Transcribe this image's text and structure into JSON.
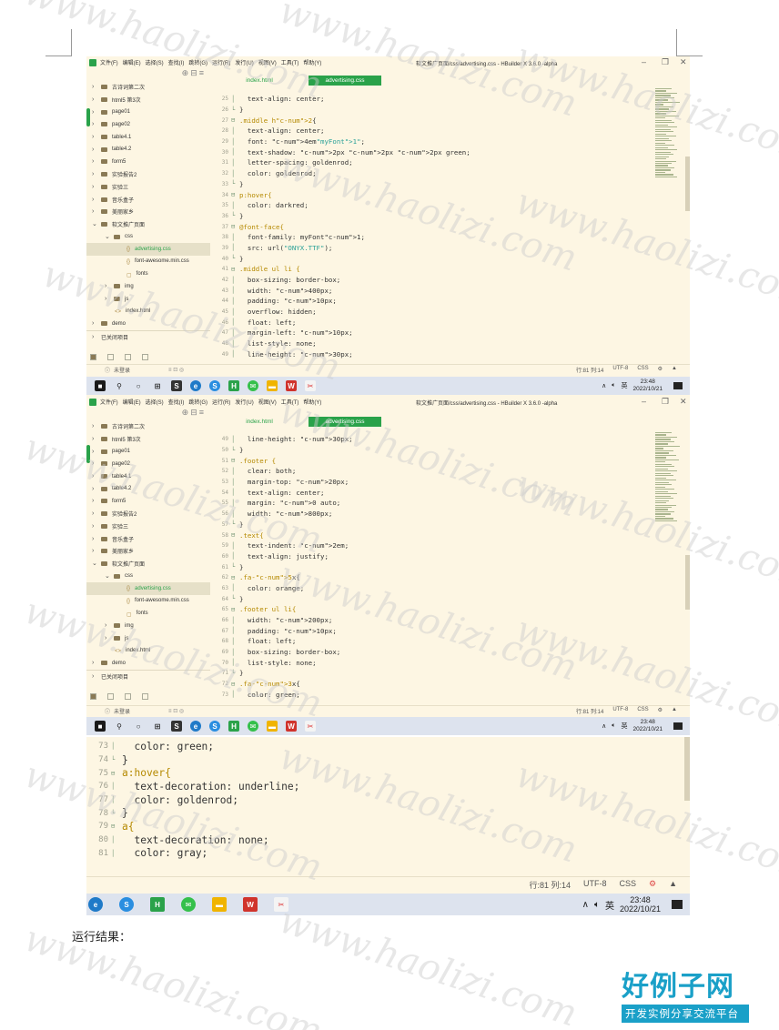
{
  "menu": {
    "items": [
      "文件(F)",
      "编辑(E)",
      "选择(S)",
      "查找(I)",
      "跳转(G)",
      "运行(R)",
      "发行(U)",
      "视图(V)",
      "工具(T)",
      "帮助(Y)"
    ],
    "window_title": "软文推广页面/css/advertising.css - HBuilder X 3.6.0 -alpha"
  },
  "tabs": [
    "index.html",
    "advertising.css"
  ],
  "sidebar": {
    "items": [
      "古诗词第二次",
      "html5 第3次",
      "page01",
      "page02",
      "table4.1",
      "table4.2",
      "form5",
      "实验报告2",
      "实验三",
      "音乐盒子",
      "美丽家乡",
      "软文推广页面",
      "css",
      "advertising.css",
      "font-awesome.min.css",
      "fonts",
      "img",
      "js",
      "index.html",
      "demo"
    ],
    "closed_label": "已关闭项目",
    "login": "未登录"
  },
  "status": {
    "pos1": "行:81  列:14",
    "encoding": "UTF-8",
    "lang": "CSS"
  },
  "tray": {
    "ime": "英",
    "time": "23:48",
    "date": "2022/10/21"
  },
  "code1": [
    {
      "n": "25",
      "t": "  text-align: center;"
    },
    {
      "n": "26",
      "t": "}"
    },
    {
      "n": "27",
      "t": ".middle h2{"
    },
    {
      "n": "28",
      "t": "  text-align: center;"
    },
    {
      "n": "29",
      "t": "  font: 4em\"myFont1\";"
    },
    {
      "n": "30",
      "t": "  text-shadow: 2px 2px 2px green;"
    },
    {
      "n": "31",
      "t": "  letter-spacing: goldenrod;"
    },
    {
      "n": "32",
      "t": "  color: goldenrod;"
    },
    {
      "n": "33",
      "t": "}"
    },
    {
      "n": "34",
      "t": "p:hover{"
    },
    {
      "n": "35",
      "t": "  color: darkred;"
    },
    {
      "n": "36",
      "t": "}"
    },
    {
      "n": "37",
      "t": "@font-face{"
    },
    {
      "n": "38",
      "t": "  font-family: myFont1;"
    },
    {
      "n": "39",
      "t": "  src: url(\"ONYX.TTF\");"
    },
    {
      "n": "40",
      "t": "}"
    },
    {
      "n": "41",
      "t": ".middle ul li {"
    },
    {
      "n": "42",
      "t": "  box-sizing: border-box;"
    },
    {
      "n": "43",
      "t": "  width: 400px;"
    },
    {
      "n": "44",
      "t": "  padding: 10px;"
    },
    {
      "n": "45",
      "t": "  overflow: hidden;"
    },
    {
      "n": "46",
      "t": "  float: left;"
    },
    {
      "n": "47",
      "t": "  margin-left: 10px;"
    },
    {
      "n": "48",
      "t": "  list-style: none;"
    },
    {
      "n": "49",
      "t": "  line-height: 30px;"
    }
  ],
  "code2": [
    {
      "n": "49",
      "t": "  line-height: 30px;"
    },
    {
      "n": "50",
      "t": "}"
    },
    {
      "n": "51",
      "t": ".footer {"
    },
    {
      "n": "52",
      "t": "  clear: both;"
    },
    {
      "n": "53",
      "t": "  margin-top: 20px;"
    },
    {
      "n": "54",
      "t": "  text-align: center;"
    },
    {
      "n": "55",
      "t": "  margin: 0 auto;"
    },
    {
      "n": "56",
      "t": "  width: 800px;"
    },
    {
      "n": "57",
      "t": "}"
    },
    {
      "n": "58",
      "t": ".text{"
    },
    {
      "n": "59",
      "t": "  text-indent: 2em;"
    },
    {
      "n": "60",
      "t": "  text-align: justify;"
    },
    {
      "n": "61",
      "t": "}"
    },
    {
      "n": "62",
      "t": ".fa-5x{"
    },
    {
      "n": "63",
      "t": "  color: orange;"
    },
    {
      "n": "64",
      "t": "}"
    },
    {
      "n": "65",
      "t": ".footer ul li{"
    },
    {
      "n": "66",
      "t": "  width: 200px;"
    },
    {
      "n": "67",
      "t": "  padding: 10px;"
    },
    {
      "n": "68",
      "t": "  float: left;"
    },
    {
      "n": "69",
      "t": "  box-sizing: border-box;"
    },
    {
      "n": "70",
      "t": "  list-style: none;"
    },
    {
      "n": "71",
      "t": "}"
    },
    {
      "n": "72",
      "t": ".fa-3x{"
    },
    {
      "n": "73",
      "t": "  color: green;"
    }
  ],
  "code3": [
    {
      "n": "73",
      "t": "  color: green;"
    },
    {
      "n": "74",
      "t": "}"
    },
    {
      "n": "75",
      "t": "a:hover{"
    },
    {
      "n": "76",
      "t": "  text-decoration: underline;"
    },
    {
      "n": "77",
      "t": "  color: goldenrod;"
    },
    {
      "n": "78",
      "t": "}"
    },
    {
      "n": "79",
      "t": "a{"
    },
    {
      "n": "80",
      "t": "  text-decoration: none;"
    },
    {
      "n": "81",
      "t": "  color: gray;"
    }
  ],
  "caption": "运行结果：",
  "brand": {
    "name": "好例子网",
    "slogan": "开发实例分享交流平台"
  },
  "watermark": "www.haolizi.com"
}
